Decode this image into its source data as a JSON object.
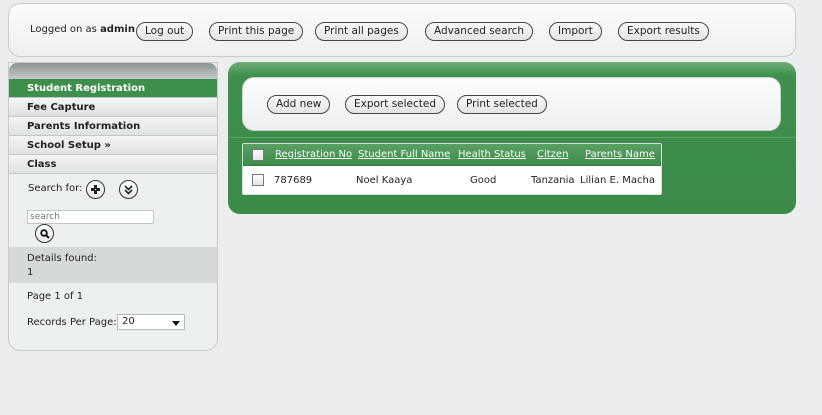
{
  "topbar": {
    "logged_prefix": "Logged on as",
    "username": "admin",
    "buttons": {
      "logout": "Log out",
      "print_page": "Print this page",
      "print_all": "Print all pages",
      "advanced_search": "Advanced search",
      "import": "Import",
      "export_results": "Export results"
    }
  },
  "sidebar": {
    "items": [
      {
        "label": "Student Registration",
        "active": true
      },
      {
        "label": "Fee Capture"
      },
      {
        "label": "Parents Information"
      },
      {
        "label": "School Setup »"
      },
      {
        "label": "Class"
      }
    ],
    "search_label": "Search for:",
    "search_placeholder": "search",
    "details_label": "Details found:",
    "details_count": "1",
    "page_info": "Page 1 of 1",
    "records_label": "Records Per Page:",
    "records_value": "20"
  },
  "actions": {
    "add_new": "Add new",
    "export_selected": "Export selected",
    "print_selected": "Print selected"
  },
  "table": {
    "headers": [
      "Registration No",
      "Student Full Name",
      "Health Status",
      "Citzen",
      "Parents Name"
    ],
    "rows": [
      [
        "787689",
        "Noel Kaaya",
        "Good",
        "Tanzania",
        "Lilian E. Macha"
      ]
    ]
  },
  "colors": {
    "accent_green": "#3d8f4b",
    "background": "#ebedee"
  },
  "icons": {
    "add_filter": "plus-circle-icon",
    "expand": "double-chevron-down-icon",
    "search": "magnifier-icon"
  }
}
